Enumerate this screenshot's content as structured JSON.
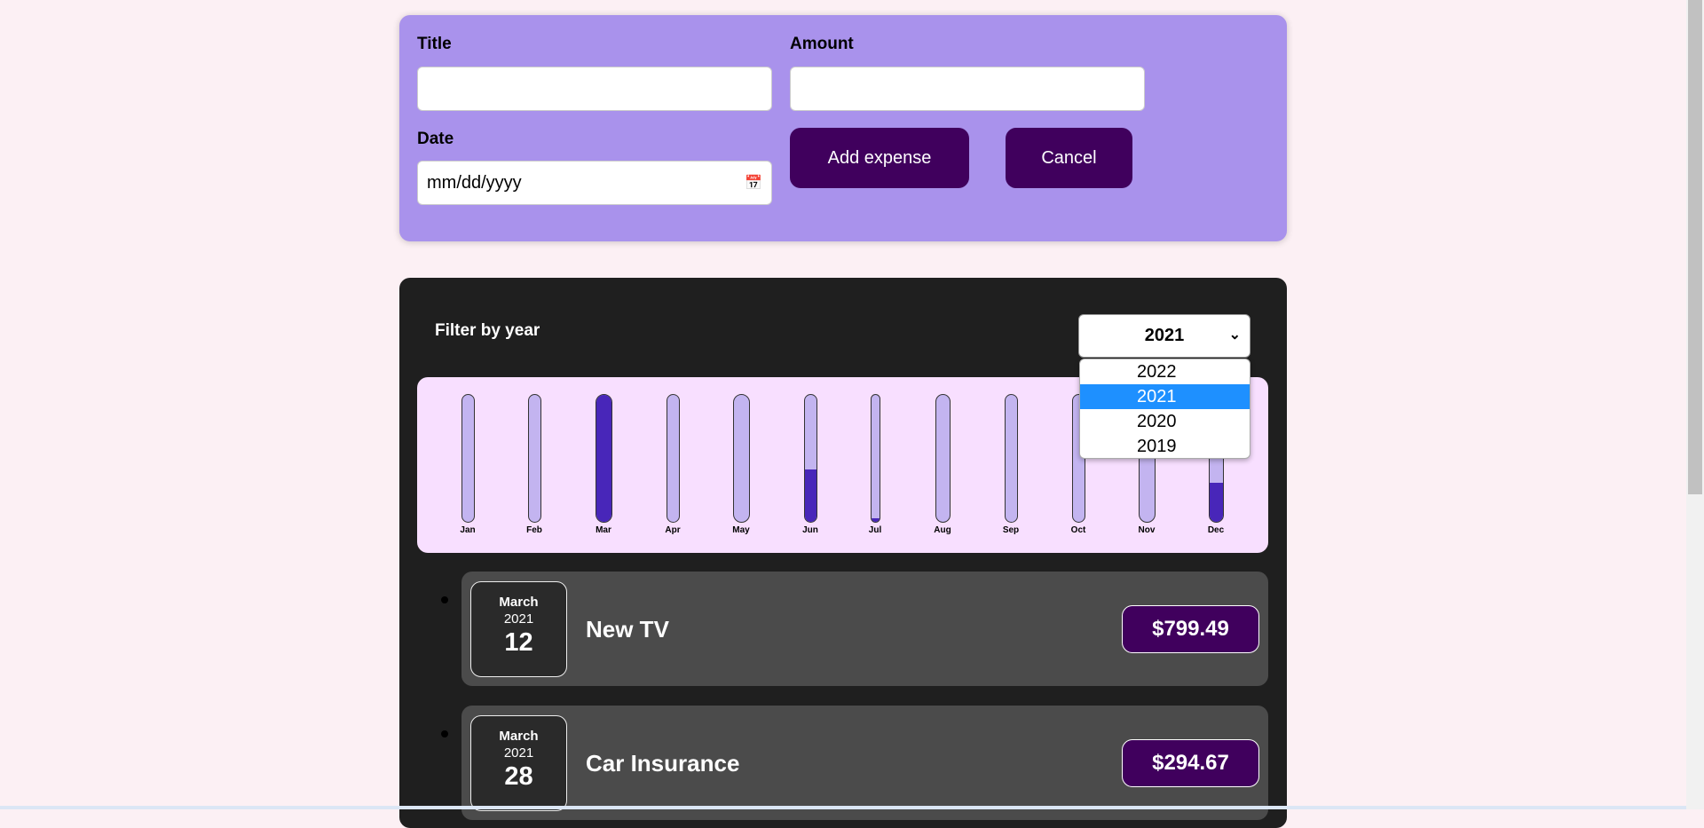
{
  "form": {
    "title_label": "Title",
    "amount_label": "Amount",
    "date_label": "Date",
    "title_value": "",
    "amount_value": "",
    "date_placeholder": "mm/dd/yyyy",
    "add_label": "Add expense",
    "cancel_label": "Cancel"
  },
  "filter": {
    "label": "Filter by year",
    "selected": "2021",
    "options": [
      "2022",
      "2021",
      "2020",
      "2019"
    ]
  },
  "chart_data": {
    "type": "bar",
    "categories": [
      "Jan",
      "Feb",
      "Mar",
      "Apr",
      "May",
      "Jun",
      "Jul",
      "Aug",
      "Sep",
      "Oct",
      "Nov",
      "Dec"
    ],
    "values": [
      0,
      0,
      1.0,
      0,
      0,
      0.41,
      0.03,
      0,
      0,
      0,
      0,
      0.31
    ],
    "ylim": [
      0,
      1
    ]
  },
  "expenses": [
    {
      "month": "March",
      "year": "2021",
      "day": "12",
      "title": "New TV",
      "amount": "$799.49"
    },
    {
      "month": "March",
      "year": "2021",
      "day": "28",
      "title": "Car Insurance",
      "amount": "$294.67"
    }
  ]
}
